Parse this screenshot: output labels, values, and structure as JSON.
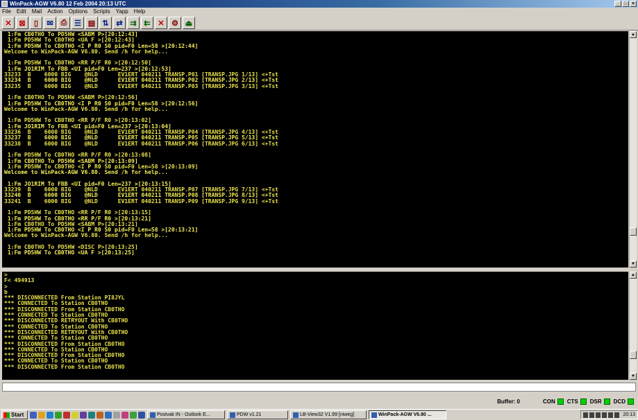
{
  "window": {
    "title": "WinPack-AGW V6.80    12 Feb 2004 20:13 UTC",
    "buttons": [
      "_",
      "□",
      "×"
    ]
  },
  "menu": [
    "File",
    "Edit",
    "Mail",
    "Action",
    "Options",
    "Scripts",
    "Yapp",
    "Help"
  ],
  "toolbar": [
    {
      "icon": "disconnect-icon",
      "glyph": "✕"
    },
    {
      "icon": "connect-icon",
      "glyph": "⊠"
    },
    {
      "icon": "monitor-icon",
      "glyph": "▯"
    },
    {
      "icon": "mailbox-icon",
      "glyph": "✉"
    },
    {
      "icon": "printer-icon",
      "glyph": "⎙"
    },
    {
      "icon": "list-icon",
      "glyph": "☰"
    },
    {
      "icon": "log-icon",
      "glyph": "▤"
    },
    {
      "icon": "scroll-icon",
      "glyph": "⇅"
    },
    {
      "icon": "yapp-icon",
      "glyph": "⇄"
    },
    {
      "icon": "send-icon",
      "glyph": "⇉"
    },
    {
      "icon": "receive-icon",
      "glyph": "⇇"
    },
    {
      "icon": "abort-icon",
      "glyph": "✕"
    },
    {
      "icon": "settings-icon",
      "glyph": "⚙"
    },
    {
      "icon": "exit-icon",
      "glyph": "⏏"
    }
  ],
  "monitor_lines": [
    " 1:Fm CB0THO To PD5HW <SABM P>[20:12:43]",
    " 1:Fm PD5HW To CB0THO <UA F >[20:12:43]",
    " 1:Fm PD5HW To CB0THO <I P R0 S0 pid=F0 Len=58 >[20:12:44]",
    "Welcome to WinPack-AGW V6.80. Send /h for help...",
    "",
    " 1:Fm PD5HW To CB0THO <RR P/F R0 >[20:12:50]",
    " 1:Fm JO1RIM To FBB <UI pid=F0 Len=237 >[20:12:53]",
    "33233  B    6000 BIG    @NLD      EV1ERT 040211 TRANSP.P01 [TRANSP.JPG 1/13] <+Tst",
    "33234  B    6000 BIG    @NLD      EV1ERT 040211 TRANSP.P02 [TRANSP.JPG 2/13] <+Tst",
    "33235  B    6000 BIG    @NLD      EV1ERT 040211 TRANSP.P03 [TRANSP.JPG 3/13] <+Tst",
    "",
    " 1:Fm CB0THO To PD5HW <SABM P>[20:12:56]",
    " 1:Fm PD5HW To CB0THO <I P R0 S0 pid=F0 Len=58 >[20:12:56]",
    "Welcome to WinPack-AGW V6.80. Send /h for help...",
    "",
    " 1:Fm PD5HW To CB0THO <RR P/F R0 >[20:13:02]",
    " 1:Fm JO1RIM To FBB <UI pid=F0 Len=237 >[20:13:04]",
    "33236  B    6000 BIG    @NLD      EV1ERT 040211 TRANSP.P04 [TRANSP.JPG 4/13] <+Tst",
    "33237  B    6000 BIG    @NLD      EV1ERT 040211 TRANSP.P05 [TRANSP.JPG 5/13] <+Tst",
    "33238  B    6000 BIG    @NLD      EV1ERT 040211 TRANSP.P06 [TRANSP.JPG 6/13] <+Tst",
    "",
    " 1:Fm PD5HW To CB0THO <RR P/F R0 >[20:13:08]",
    " 1:Fm CB0THO To PD5HW <SABM P>[20:13:09]",
    " 1:Fm PD5HW To CB0THO <I P R0 S0 pid=F0 Len=58 >[20:13:09]",
    "Welcome to WinPack-AGW V6.80. Send /h for help...",
    "",
    " 1:Fm JO1RIM To FBB <UI pid=F0 Len=237 >[20:13:15]",
    "33239  B    6000 BIG    @NLD      EV1ERT 040211 TRANSP.P07 [TRANSP.JPG 7/13] <+Tst",
    "33240  B    6000 BIG    @NLD      EV1ERT 040211 TRANSP.P08 [TRANSP.JPG 8/13] <+Tst",
    "33241  B    6000 BIG    @NLD      EV1ERT 040211 TRANSP.P09 [TRANSP.JPG 9/13] <+Tst",
    "",
    " 1:Fm PD5HW To CB0THO <RR P/F R0 >[20:13:15]",
    " 1:Fm PD5HW To CB0THO <RR P/F R0 >[20:13:21]",
    " 1:Fm CB0THO To PD5HW <SABM P>[20:13:21]",
    " 1:Fm PD5HW To CB0THO <I P R0 S0 pid=F0 Len=58 >[20:13:21]",
    "Welcome to WinPack-AGW V6.80. Send /h for help...",
    "",
    " 1:Fm CB0THO To PD5HW <DISC P>[20:13:25]",
    " 1:Fm PD5HW To CB0THO <UA F >[20:13:25]"
  ],
  "session_lines": [
    ">",
    "F< 494913",
    ">",
    "b",
    "*** DISCONNECTED From Station PI8JYL",
    "*** CONNECTED To Station CB0THO",
    "*** DISCONNECTED From Station CB0THO",
    "*** CONNECTED To Station CB0THO",
    "*** DISCONNECTED RETRYOUT With CB0THO",
    "*** CONNECTED To Station CB0THO",
    "*** DISCONNECTED RETRYOUT With CB0THO",
    "*** CONNECTED To Station CB0THO",
    "*** DISCONNECTED From Station CB0THO",
    "*** CONNECTED To Station CB0THO",
    "*** DISCONNECTED From Station CB0THO",
    "*** CONNECTED To Station CB0THO",
    "*** DISCONNECTED From Station CB0THO"
  ],
  "input": {
    "value": ""
  },
  "status": {
    "buffer": "Buffer: 0",
    "indicators": [
      "CON",
      "CTS",
      "DSR",
      "DCD"
    ],
    "led_color": "#00d000"
  },
  "taskbar": {
    "start": "Start",
    "quicklaunch_colors": [
      "#4060c0",
      "#e0a020",
      "#2080d0",
      "#30a030",
      "#c03030",
      "#d0d030",
      "#6040a0",
      "#208080",
      "#c06020",
      "#3070c0",
      "#a0a0a0",
      "#c04080",
      "#40a040",
      "#3050a0"
    ],
    "tasks": [
      {
        "label": "Postvak IN - Outlook E...",
        "active": false
      },
      {
        "label": "PDW v1.21",
        "active": false
      },
      {
        "label": "LB-View32 V1.99 [niweg]",
        "active": false
      },
      {
        "label": "WinPack-AGW V6.80 ...",
        "active": true
      }
    ],
    "clock": "20:13"
  }
}
